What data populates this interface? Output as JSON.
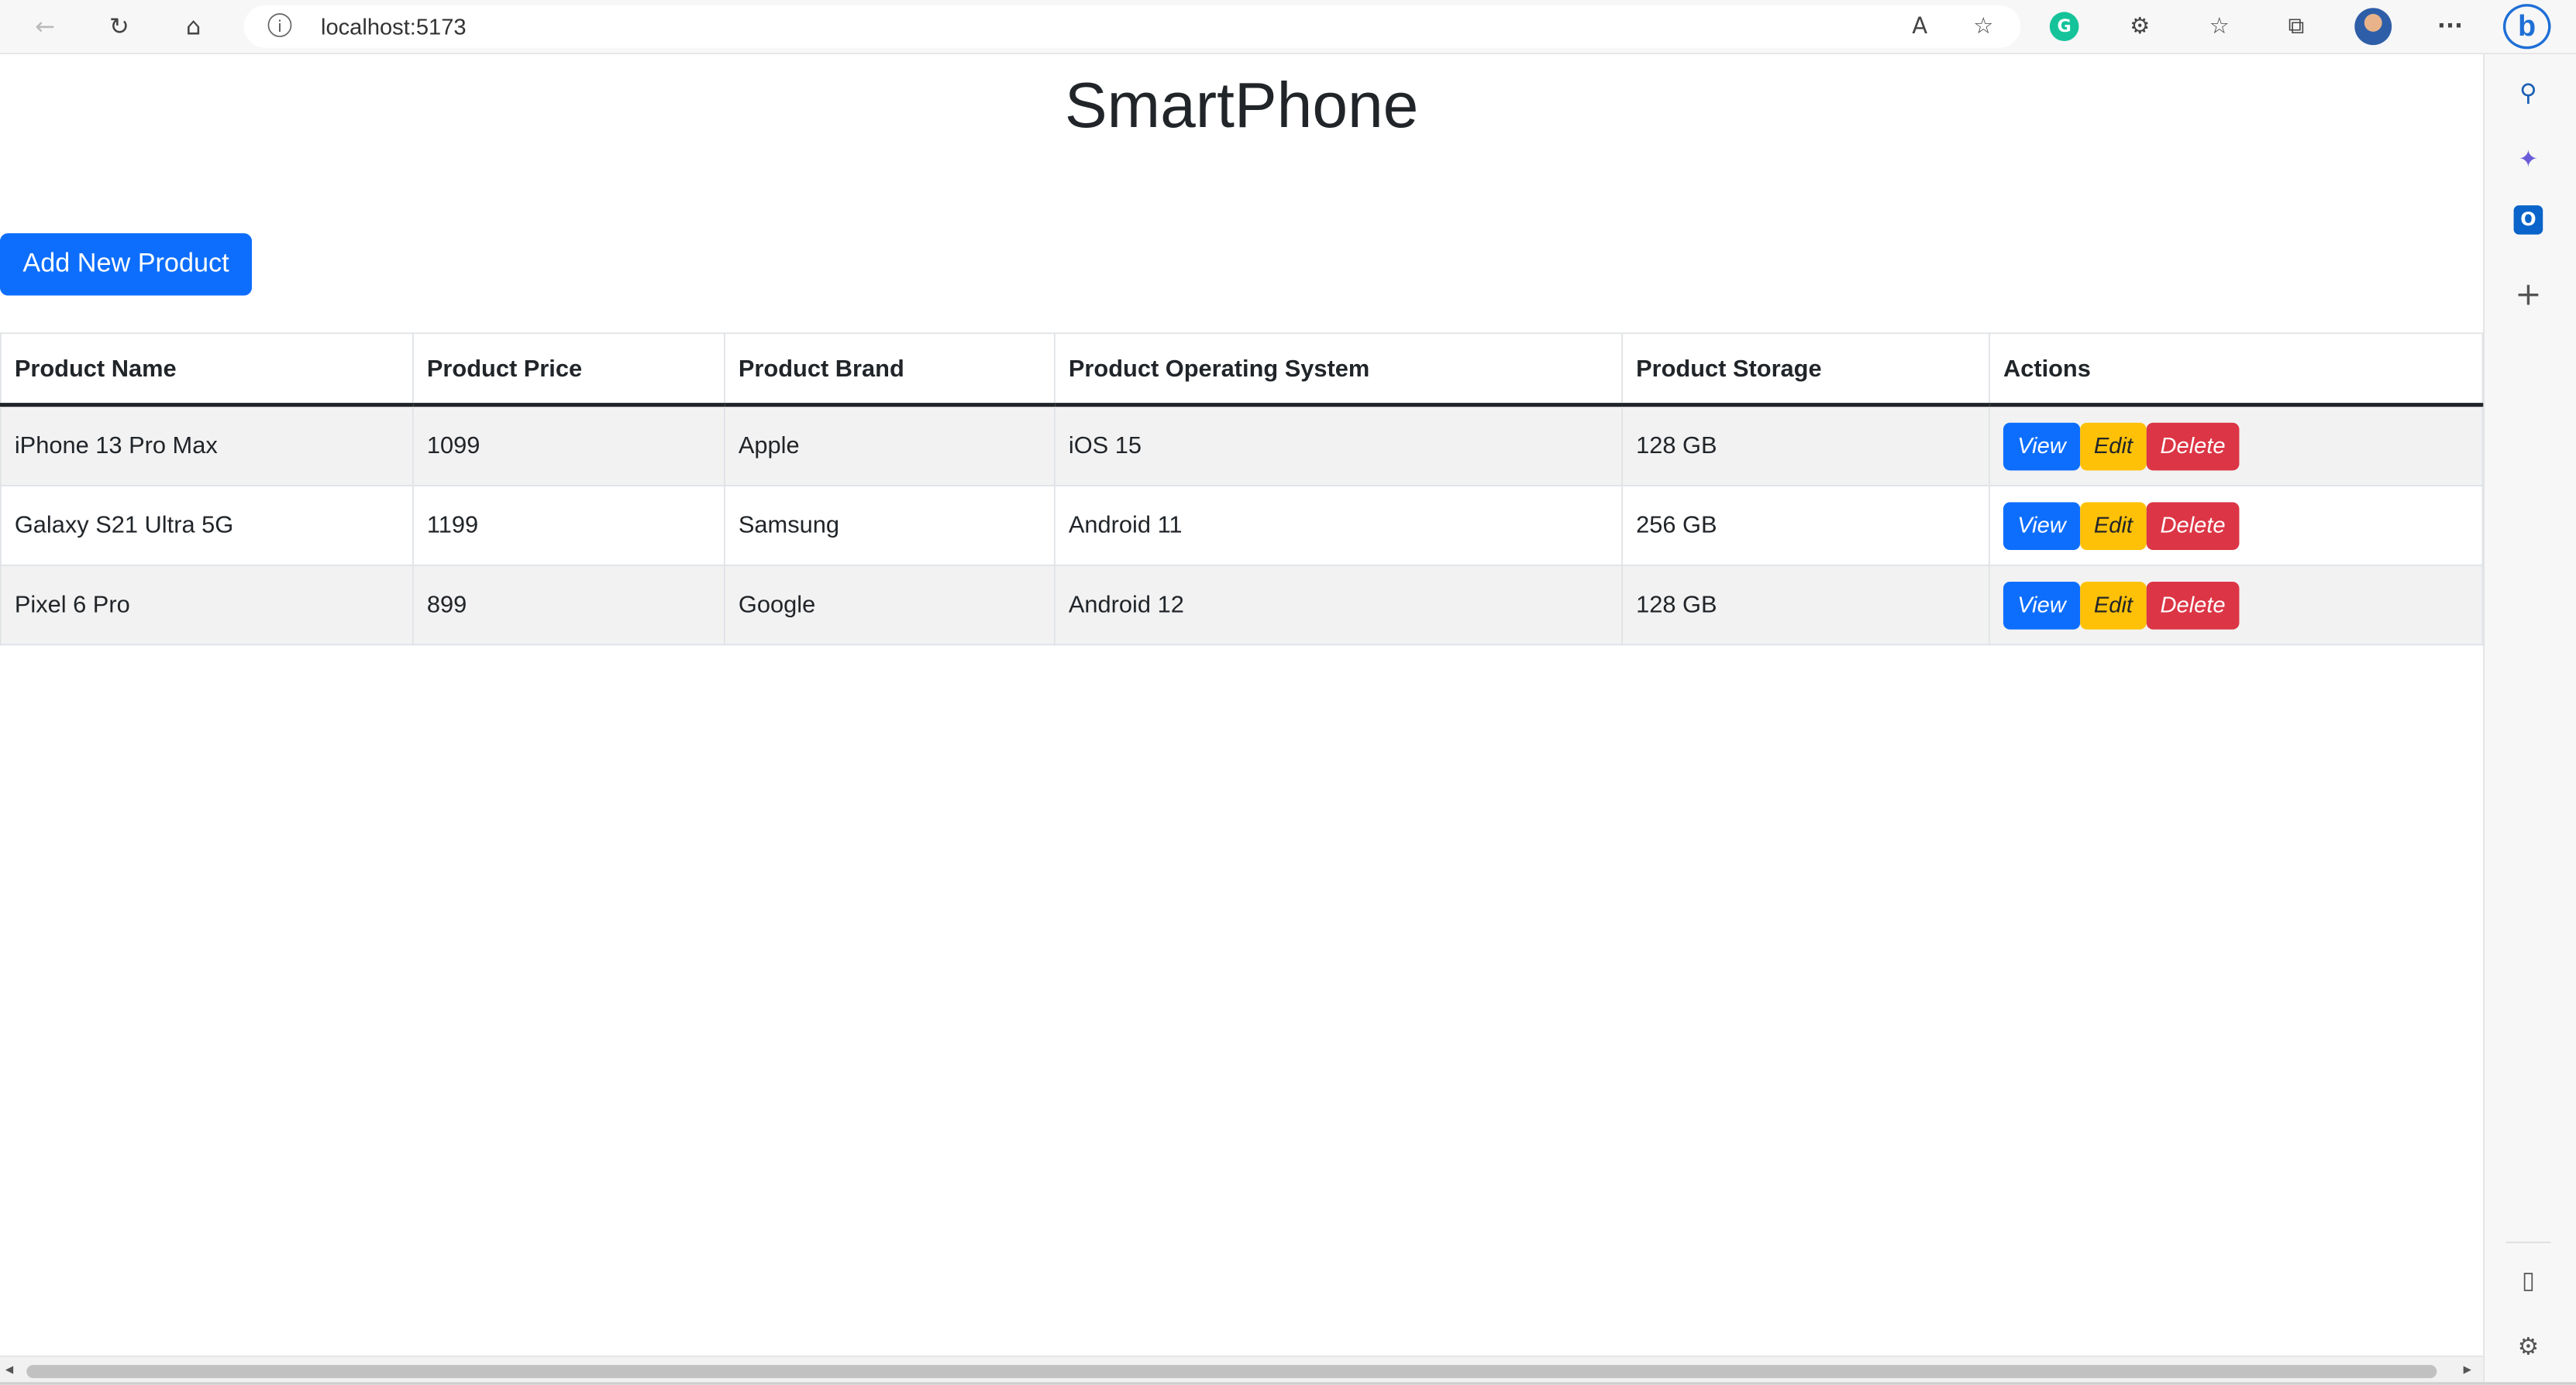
{
  "browser": {
    "url": "localhost:5173",
    "icons": {
      "back": "back-arrow-icon",
      "refresh": "refresh-icon",
      "home": "home-icon",
      "info": "info-icon",
      "read_aloud": "read-aloud-icon",
      "favorite_add": "add-favorite-icon",
      "grammarly": "grammarly-icon",
      "extensions": "extensions-icon",
      "favorites": "favorites-icon",
      "collections": "collections-icon",
      "more": "more-icon",
      "copilot": "copilot-icon"
    },
    "glyphs": {
      "back": "←",
      "refresh": "↻",
      "home": "⌂",
      "info": "i",
      "read_aloud": "A",
      "favorite_add": "☆",
      "grammarly": "G",
      "extensions": "⚙",
      "favorites": "☆",
      "collections": "⧉",
      "more": "···",
      "copilot": "b"
    }
  },
  "sidebar": {
    "glyphs": {
      "search": "⚲",
      "copilot": "✦",
      "outlook": "O",
      "add": "+",
      "layout": "▯",
      "settings": "⚙"
    },
    "colors": {
      "copilot": "#6a5cd8",
      "outlook": "#0a64c9"
    }
  },
  "page": {
    "title": "SmartPhone",
    "add_button": "Add New Product",
    "columns": [
      "Product Name",
      "Product Price",
      "Product Brand",
      "Product Operating System",
      "Product Storage",
      "Actions"
    ],
    "rows": [
      {
        "name": "iPhone 13 Pro Max",
        "price": "1099",
        "brand": "Apple",
        "os": "iOS 15",
        "storage": "128 GB"
      },
      {
        "name": "Galaxy S21 Ultra 5G",
        "price": "1199",
        "brand": "Samsung",
        "os": "Android 11",
        "storage": "256 GB"
      },
      {
        "name": "Pixel 6 Pro",
        "price": "899",
        "brand": "Google",
        "os": "Android 12",
        "storage": "128 GB"
      }
    ],
    "actions": {
      "view": "View",
      "edit": "Edit",
      "delete": "Delete"
    },
    "colors": {
      "primary": "#0d6efd",
      "warning": "#ffc107",
      "danger": "#dc3545"
    }
  },
  "scrollbar": {
    "left_arrow": "◂",
    "right_arrow": "▸"
  }
}
